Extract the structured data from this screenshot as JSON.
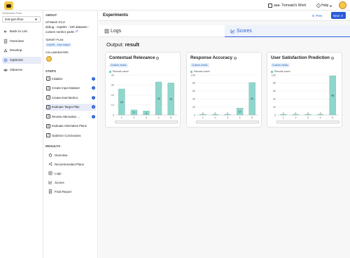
{
  "app": {
    "flow_label": "Generation Flow",
    "flow_value": "test-gen-flow",
    "workspace": "aaa- Tomoaki's Work",
    "help": "Help"
  },
  "nav": {
    "items": [
      {
        "label": "Back to List"
      },
      {
        "label": "Overview"
      },
      {
        "label": "Develop"
      },
      {
        "label": "Optimize"
      },
      {
        "label": "Observe"
      }
    ]
  },
  "about": {
    "heading": "ABOUT",
    "optimize_title_label": "OPTIMIZE TITLE",
    "optimize_title": "debug - exp001 - 100 datasets - custom metrics part6",
    "target_plan_label": "TARGET PLAN",
    "target_plan": "exp001 - new output",
    "collaborators_label": "COLLABORATORS"
  },
  "steps": {
    "heading": "STEPS",
    "items": [
      {
        "num": "1",
        "label": "Initialize",
        "done": true
      },
      {
        "num": "2",
        "label": "Create Input Dataset",
        "done": true
      },
      {
        "num": "3",
        "label": "Create Eval Metrics",
        "done": true
      },
      {
        "num": "4",
        "label": "Evaluate Target Plan",
        "done": true
      },
      {
        "num": "5",
        "label": "Review Alternative ...",
        "done": true
      },
      {
        "num": "6",
        "label": "Evaluate Alternative Plans",
        "done": false
      },
      {
        "num": "7",
        "label": "Optimize Conclusions",
        "done": false
      }
    ]
  },
  "results": {
    "heading": "RESULTS",
    "items": [
      {
        "label": "Overview"
      },
      {
        "label": "Recommended Plans"
      },
      {
        "label": "Logs"
      },
      {
        "label": "Scores"
      },
      {
        "label": "Final Report"
      }
    ]
  },
  "main": {
    "title": "Experiments",
    "prev": "Prev",
    "next": "Next",
    "tabs": [
      {
        "label": "Logs",
        "active": false
      },
      {
        "label": "Scores",
        "active": true
      }
    ],
    "output_label": "Output:",
    "output_value": "result"
  },
  "chart_data": [
    {
      "type": "bar",
      "title": "Contextual Relevance",
      "badge": "Custom metric",
      "series": [
        {
          "name": "Record count",
          "values": [
            26,
            5,
            4,
            33,
            32
          ]
        }
      ],
      "categories": [
        "1",
        "2",
        "3",
        "4",
        "5"
      ],
      "ylim": [
        0,
        40
      ],
      "yticks": [
        0,
        10,
        20,
        30,
        40
      ],
      "color": "#8fd6cc",
      "legend": "top-left"
    },
    {
      "type": "bar",
      "title": "Response Accuracy",
      "badge": "Custom metric",
      "series": [
        {
          "name": "Record count",
          "values": [
            0,
            0,
            0,
            17,
            81
          ]
        }
      ],
      "categories": [
        "1",
        "2",
        "3",
        "4",
        "5"
      ],
      "ylim": [
        0,
        100
      ],
      "yticks": [
        0,
        20,
        40,
        60,
        80,
        100
      ],
      "color": "#8fd6cc",
      "legend": "top-left"
    },
    {
      "type": "bar",
      "title": "User Satisfaction Prediction",
      "badge": "Custom metric",
      "series": [
        {
          "name": "Record count",
          "values": [
            0,
            0,
            0,
            0,
            98
          ]
        }
      ],
      "categories": [
        "1",
        "2",
        "3",
        "4",
        "5"
      ],
      "ylim": [
        0,
        100
      ],
      "yticks": [
        0,
        20,
        40,
        60,
        80,
        100
      ],
      "color": "#8fd6cc",
      "legend": "top-left"
    }
  ]
}
